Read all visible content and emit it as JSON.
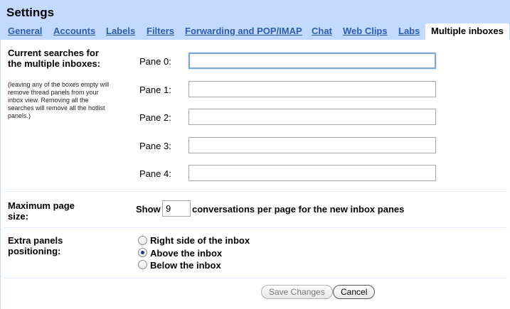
{
  "title": "Settings",
  "tabs": [
    {
      "label": "General"
    },
    {
      "label": "Accounts"
    },
    {
      "label": "Labels"
    },
    {
      "label": "Filters"
    },
    {
      "label": "Forwarding and POP/IMAP"
    },
    {
      "label": "Chat"
    },
    {
      "label": "Web Clips"
    },
    {
      "label": "Labs"
    },
    {
      "label": "Multiple inboxes"
    }
  ],
  "searches": {
    "heading": "Current searches for the multiple inboxes:",
    "note": "(leaving any of the boxes empty will remove thread panels from your inbox view. Removing all the searches will remove all the hotlist panels.)",
    "panes": [
      {
        "label": "Pane 0:",
        "value": ""
      },
      {
        "label": "Pane 1:",
        "value": ""
      },
      {
        "label": "Pane 2:",
        "value": ""
      },
      {
        "label": "Pane 3:",
        "value": ""
      },
      {
        "label": "Pane 4:",
        "value": ""
      }
    ]
  },
  "page_size": {
    "heading": "Maximum page size:",
    "prefix": "Show",
    "value": "9",
    "suffix": "conversations per page for the new inbox panes"
  },
  "positioning": {
    "heading": "Extra panels positioning:",
    "options": [
      {
        "label": "Right side of the inbox",
        "checked": false
      },
      {
        "label": "Above the inbox",
        "checked": true
      },
      {
        "label": "Below the inbox",
        "checked": false
      }
    ]
  },
  "buttons": {
    "save": "Save Changes",
    "cancel": "Cancel"
  }
}
